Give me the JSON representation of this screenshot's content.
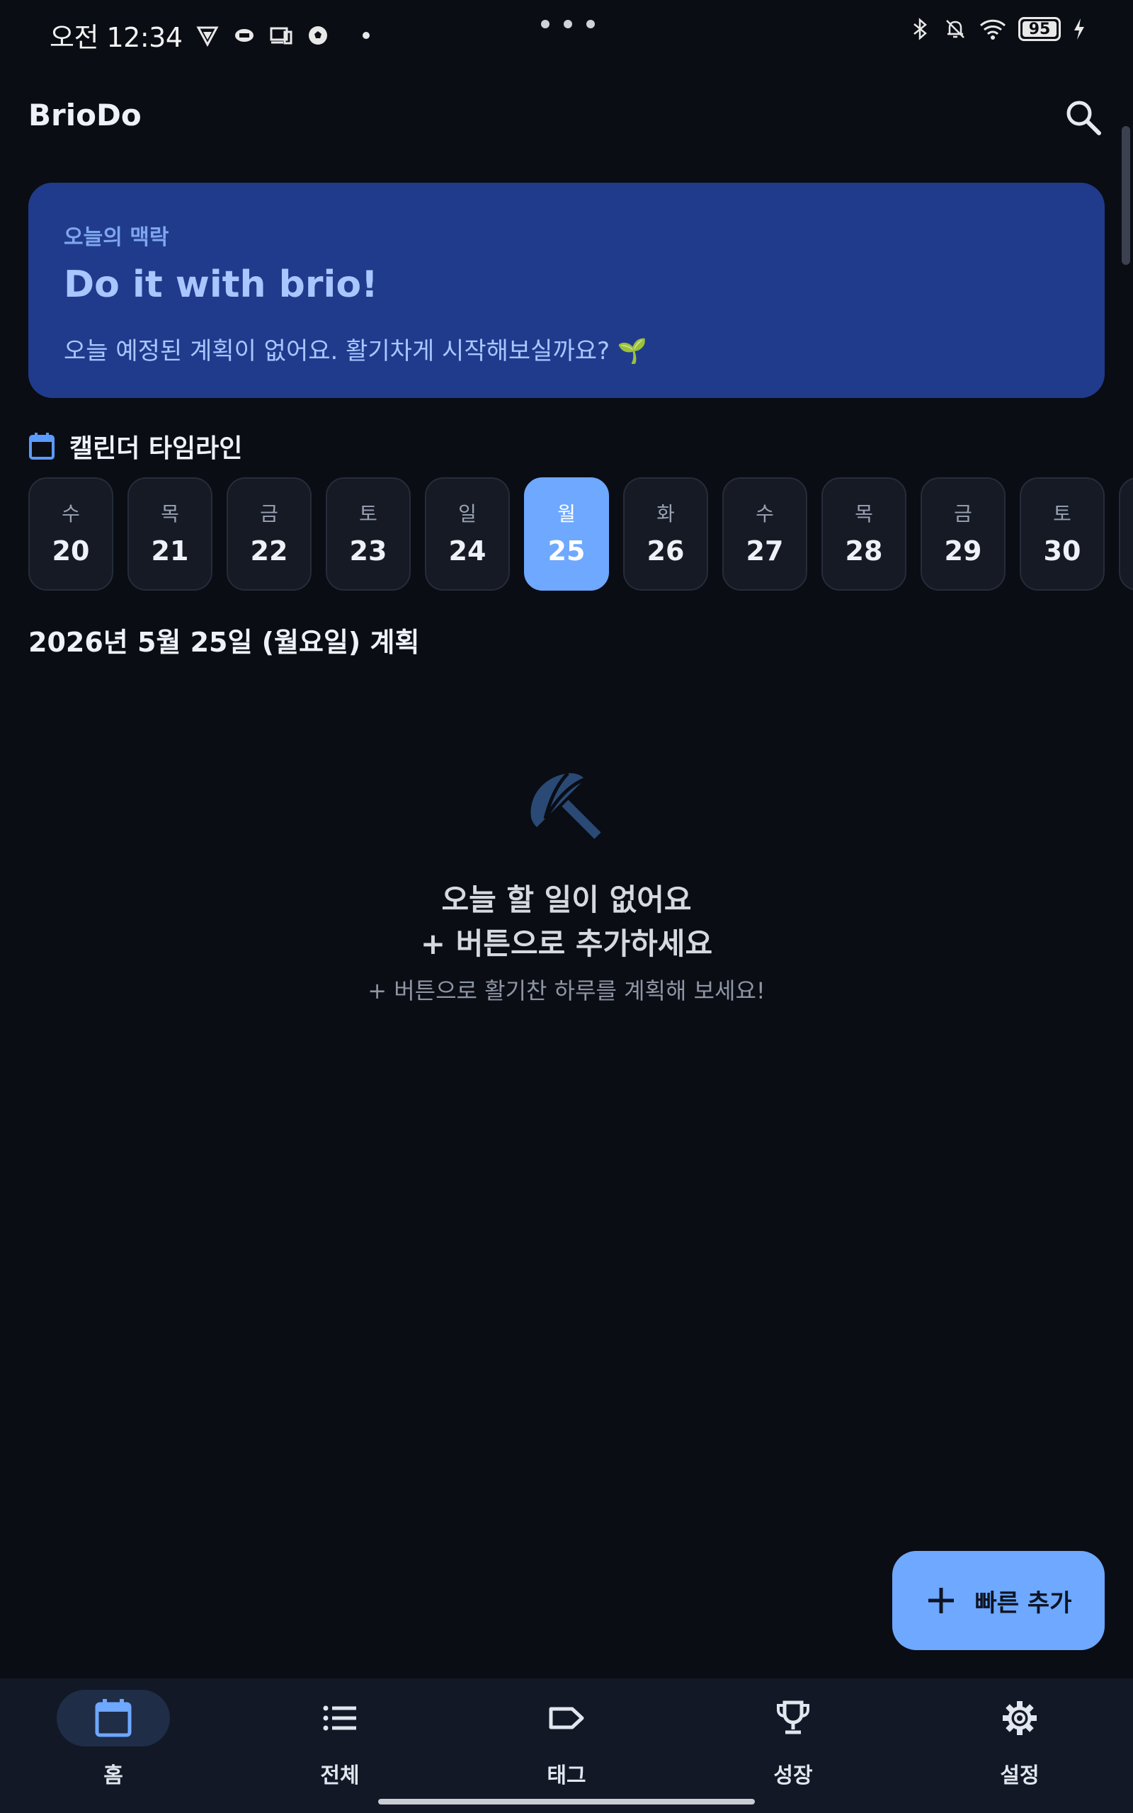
{
  "status_bar": {
    "time": "오전 12:34",
    "battery": "95",
    "icons": [
      "vpn-icon",
      "link-icon",
      "cast-icon",
      "soccer-icon",
      "bluetooth-icon",
      "bell-off-icon",
      "wifi-icon",
      "battery-icon",
      "charging-icon"
    ]
  },
  "app": {
    "title": "BrioDo"
  },
  "hero": {
    "label": "오늘의 맥락",
    "title": "Do it with brio!",
    "message": "오늘 예정된 계획이 없어요. 활기차게 시작해보실까요? 🌱"
  },
  "calendar": {
    "title": "캘린더 타임라인",
    "days": [
      {
        "dow": "수",
        "date": "20"
      },
      {
        "dow": "목",
        "date": "21"
      },
      {
        "dow": "금",
        "date": "22"
      },
      {
        "dow": "토",
        "date": "23"
      },
      {
        "dow": "일",
        "date": "24"
      },
      {
        "dow": "월",
        "date": "25",
        "selected": true
      },
      {
        "dow": "화",
        "date": "26"
      },
      {
        "dow": "수",
        "date": "27"
      },
      {
        "dow": "목",
        "date": "28"
      },
      {
        "dow": "금",
        "date": "29"
      },
      {
        "dow": "토",
        "date": "30"
      },
      {
        "dow": "",
        "date": ""
      }
    ]
  },
  "plan": {
    "title": "2026년 5월 25일 (월요일) 계획"
  },
  "empty_state": {
    "icon": "umbrella-icon",
    "title_line1": "오늘 할 일이 없어요",
    "title_line2": "+ 버튼으로 추가하세요",
    "subtitle": "+ 버튼으로 활기찬 하루를 계획해 보세요!"
  },
  "fab": {
    "label": "빠른 추가"
  },
  "bottom_nav": [
    {
      "label": "홈",
      "icon": "calendar-icon",
      "active": true
    },
    {
      "label": "전체",
      "icon": "list-icon",
      "active": false
    },
    {
      "label": "태그",
      "icon": "tag-icon",
      "active": false
    },
    {
      "label": "성장",
      "icon": "trophy-icon",
      "active": false
    },
    {
      "label": "설정",
      "icon": "gear-icon",
      "active": false
    }
  ],
  "colors": {
    "background": "#0a0d14",
    "hero_bg": "#203b8c",
    "accent": "#6ea8ff",
    "nav_bg": "#121826"
  }
}
